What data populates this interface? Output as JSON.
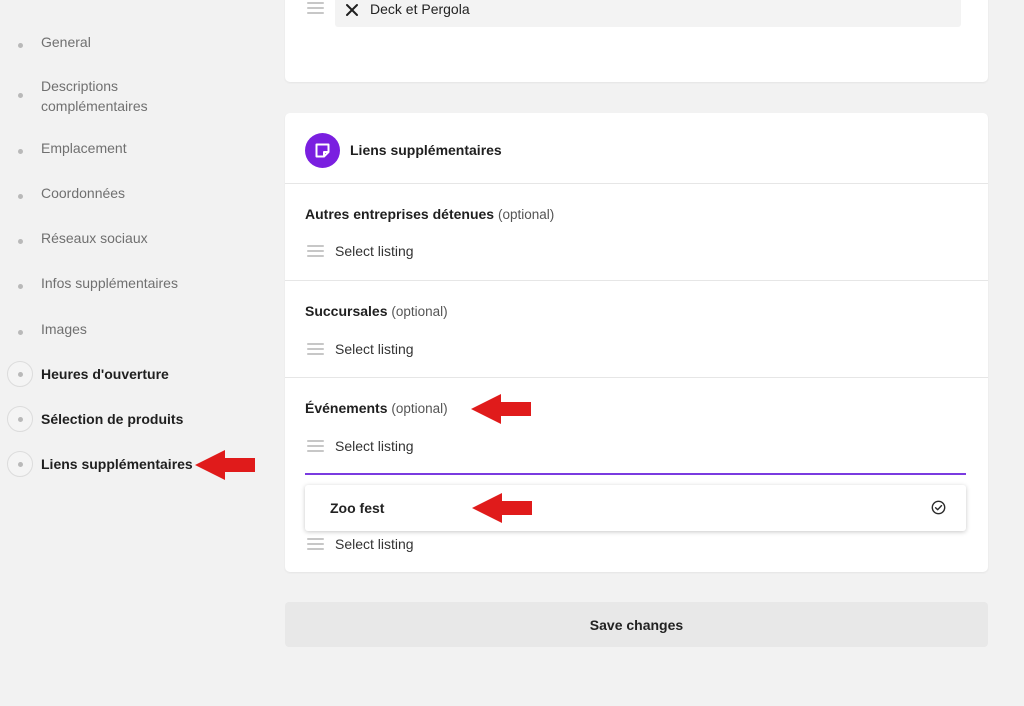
{
  "sidebar": {
    "items": [
      {
        "label": "General",
        "bold": false
      },
      {
        "label": "Descriptions complémentaires",
        "bold": false
      },
      {
        "label": "Emplacement",
        "bold": false
      },
      {
        "label": "Coordonnées",
        "bold": false
      },
      {
        "label": "Réseaux sociaux",
        "bold": false
      },
      {
        "label": "Infos supplémentaires",
        "bold": false
      },
      {
        "label": "Images",
        "bold": false
      },
      {
        "label": "Heures d'ouverture",
        "bold": true
      },
      {
        "label": "Sélection de produits",
        "bold": true
      },
      {
        "label": "Liens supplémentaires",
        "bold": true
      }
    ]
  },
  "top_card": {
    "selected_item": "Deck et Pergola"
  },
  "links_card": {
    "title": "Liens supplémentaires",
    "sections": [
      {
        "label": "Autres entreprises détenues",
        "optional": "(optional)",
        "placeholder": "Select listing"
      },
      {
        "label": "Succursales",
        "optional": "(optional)",
        "placeholder": "Select listing"
      },
      {
        "label": "Événements",
        "optional": "(optional)",
        "placeholder": "Select listing"
      }
    ],
    "dropdown_option": "Zoo fest",
    "extra_placeholder": "Select listing"
  },
  "save_button": "Save changes",
  "colors": {
    "accent": "#7a1fe0",
    "annotation_arrow": "#e01b1b"
  }
}
